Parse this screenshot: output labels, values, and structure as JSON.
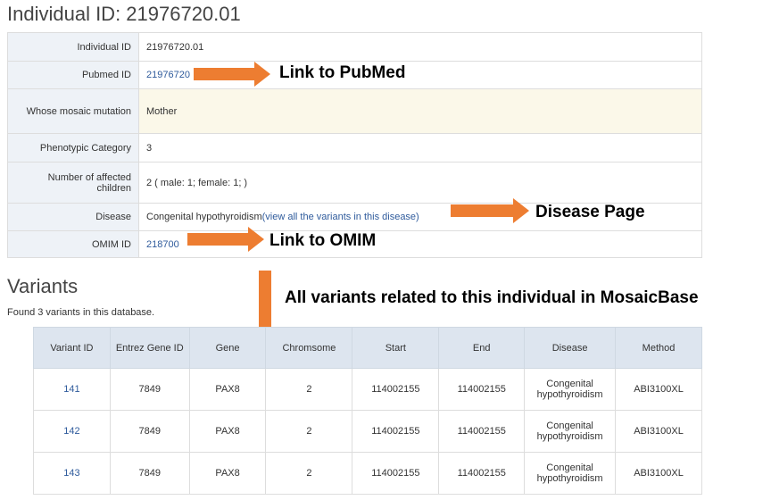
{
  "page_title": "Individual ID: 21976720.01",
  "info_rows": [
    {
      "label": "Individual ID",
      "value": "21976720.01"
    },
    {
      "label": "Pubmed ID",
      "value": "21976720"
    },
    {
      "label": "Whose mosaic mutation",
      "value": "Mother"
    },
    {
      "label": "Phenotypic Category",
      "value": "3"
    },
    {
      "label": "Number of affected children",
      "value": "2 ( male: 1; female: 1; )"
    },
    {
      "label": "Disease",
      "value": "Congenital hypothyroidism",
      "link": "(view all the variants in this disease)"
    },
    {
      "label": "OMIM ID",
      "value": "218700"
    }
  ],
  "annotations": {
    "pubmed": "Link to PubMed",
    "disease": "Disease Page",
    "omim": "Link to OMIM",
    "variants": "All variants related to this individual in MosaicBase"
  },
  "variants": {
    "heading": "Variants",
    "found_text": "Found 3 variants in this database.",
    "headers": [
      "Variant ID",
      "Entrez Gene ID",
      "Gene",
      "Chromsome",
      "Start",
      "End",
      "Disease",
      "Method"
    ],
    "rows": [
      [
        "141",
        "7849",
        "PAX8",
        "2",
        "114002155",
        "114002155",
        "Congenital hypothyroidism",
        "ABI3100XL"
      ],
      [
        "142",
        "7849",
        "PAX8",
        "2",
        "114002155",
        "114002155",
        "Congenital hypothyroidism",
        "ABI3100XL"
      ],
      [
        "143",
        "7849",
        "PAX8",
        "2",
        "114002155",
        "114002155",
        "Congenital hypothyroidism",
        "ABI3100XL"
      ]
    ]
  },
  "colors": {
    "arrow": "#ed7d31",
    "link": "#2f5b9c",
    "header_bg": "#dde5ef",
    "label_bg": "#eef2f7",
    "highlight_bg": "#fbf8e9"
  }
}
